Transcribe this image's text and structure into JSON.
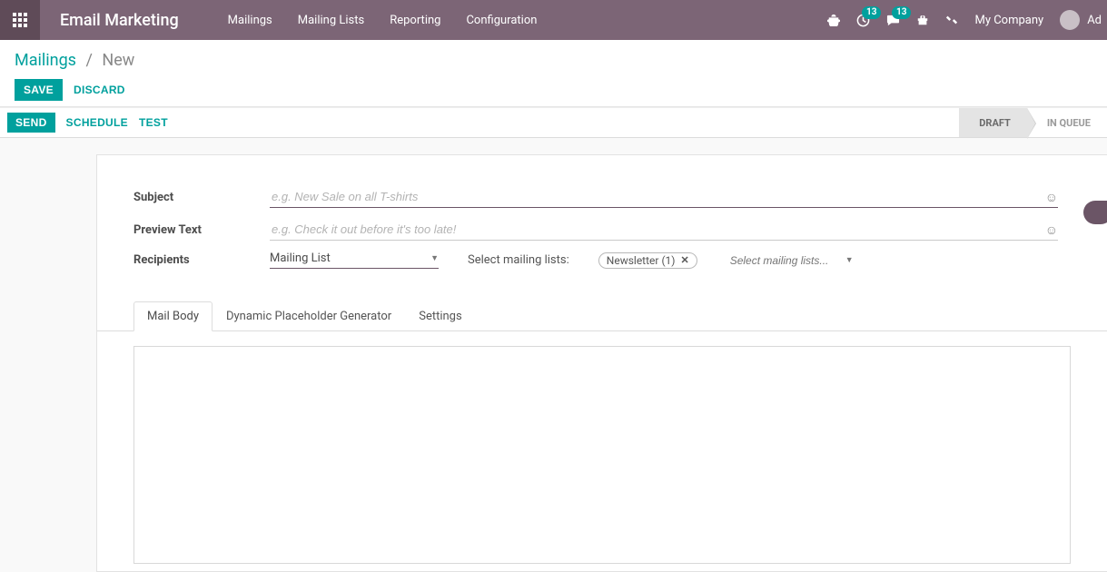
{
  "navbar": {
    "app_title": "Email Marketing",
    "menu": [
      "Mailings",
      "Mailing Lists",
      "Reporting",
      "Configuration"
    ],
    "activities_count": "13",
    "messages_count": "13",
    "company": "My Company",
    "user_short": "Ad"
  },
  "breadcrumb": {
    "root": "Mailings",
    "current": "New"
  },
  "buttons": {
    "save": "SAVE",
    "discard": "DISCARD",
    "send": "SEND",
    "schedule": "SCHEDULE",
    "test": "TEST"
  },
  "stages": {
    "draft": "DRAFT",
    "in_queue": "IN QUEUE"
  },
  "fields": {
    "subject_label": "Subject",
    "subject_placeholder": "e.g. New Sale on all T-shirts",
    "preview_label": "Preview Text",
    "preview_placeholder": "e.g. Check it out before it's too late!",
    "recipients_label": "Recipients",
    "recipients_value": "Mailing List",
    "select_ml_label": "Select mailing lists:",
    "ml_tag": "Newsletter (1)",
    "ml_add_placeholder": "Select mailing lists..."
  },
  "tabs": {
    "mail_body": "Mail Body",
    "placeholder_gen": "Dynamic Placeholder Generator",
    "settings": "Settings"
  }
}
